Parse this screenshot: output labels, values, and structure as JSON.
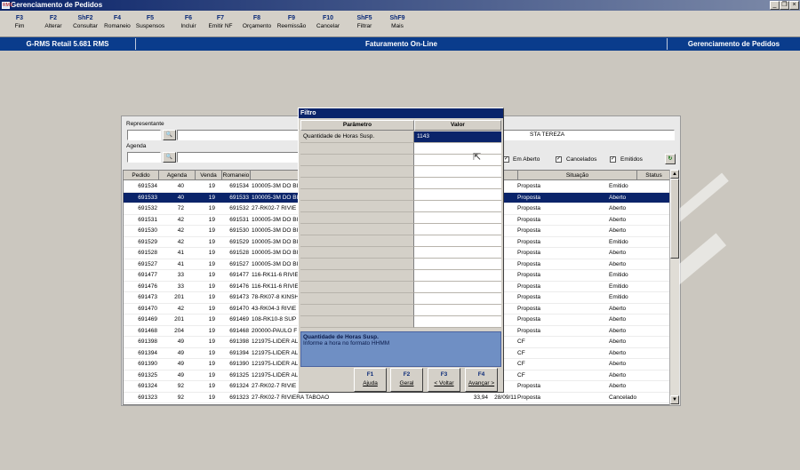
{
  "window": {
    "title": "Gerenciamento de Pedidos",
    "app_icon_text": "RMS"
  },
  "toolbar": [
    {
      "key": "F3",
      "label": "Fim"
    },
    {
      "key": "F2",
      "label": "Alterar"
    },
    {
      "key": "ShF2",
      "label": "Consultar"
    },
    {
      "key": "F4",
      "label": "Romaneio"
    },
    {
      "key": "F5",
      "label": "Suspensos"
    },
    {
      "key": "F6",
      "label": "Incluir"
    },
    {
      "key": "F7",
      "label": "Emitir NF"
    },
    {
      "key": "F8",
      "label": "Orçamento"
    },
    {
      "key": "F9",
      "label": "Reemissão"
    },
    {
      "key": "F10",
      "label": "Cancelar"
    },
    {
      "key": "ShF5",
      "label": "Filtrar"
    },
    {
      "key": "ShF9",
      "label": "Mais"
    }
  ],
  "banner": {
    "left": "G-RMS Retail 5.681 RMS",
    "center": "Faturamento On-Line",
    "right": "Gerenciamento de Pedidos"
  },
  "form": {
    "representante_label": "Representante",
    "agenda_label": "Agenda",
    "visible_name": "STA TEREZA",
    "chk_em_aberto": "Em Aberto",
    "chk_cancelados": "Cancelados",
    "chk_emitidos": "Emitidos"
  },
  "grid": {
    "headers": [
      "Pedido",
      "Agenda",
      "Venda",
      "Romaneio",
      "Situação",
      "Status"
    ],
    "rows": [
      [
        "691534",
        "40",
        "19",
        "691534",
        "100005-3M DO BI",
        "",
        "",
        "Proposta",
        "Emitido"
      ],
      [
        "691533",
        "40",
        "19",
        "691533",
        "100005-3M DO BI",
        "",
        "",
        "Proposta",
        "Aberto"
      ],
      [
        "691532",
        "72",
        "19",
        "691532",
        "27-RK02-7 RIVIE",
        "",
        "",
        "Proposta",
        "Aberto"
      ],
      [
        "691531",
        "42",
        "19",
        "691531",
        "100005-3M DO BI",
        "",
        "",
        "Proposta",
        "Aberto"
      ],
      [
        "691530",
        "42",
        "19",
        "691530",
        "100005-3M DO BI",
        "",
        "",
        "Proposta",
        "Aberto"
      ],
      [
        "691529",
        "42",
        "19",
        "691529",
        "100005-3M DO BI",
        "",
        "",
        "Proposta",
        "Emitido"
      ],
      [
        "691528",
        "41",
        "19",
        "691528",
        "100005-3M DO BI",
        "",
        "",
        "Proposta",
        "Aberto"
      ],
      [
        "691527",
        "41",
        "19",
        "691527",
        "100005-3M DO BI",
        "",
        "",
        "Proposta",
        "Aberto"
      ],
      [
        "691477",
        "33",
        "19",
        "691477",
        "116-RK11-6 RIVIE",
        "",
        "",
        "Proposta",
        "Emitido"
      ],
      [
        "691476",
        "33",
        "19",
        "691476",
        "116-RK11-6 RIVIE",
        "",
        "",
        "Proposta",
        "Emitido"
      ],
      [
        "691473",
        "201",
        "19",
        "691473",
        "78-RK07-8 KINSH",
        "",
        "",
        "Proposta",
        "Emitido"
      ],
      [
        "691470",
        "42",
        "19",
        "691470",
        "43-RK04-3 RIVIE",
        "",
        "",
        "Proposta",
        "Aberto"
      ],
      [
        "691469",
        "201",
        "19",
        "691469",
        "108-RK10-8 SUP",
        "",
        "",
        "Proposta",
        "Aberto"
      ],
      [
        "691468",
        "204",
        "19",
        "691468",
        "200000-PAULO F",
        "",
        "",
        "Proposta",
        "Aberto"
      ],
      [
        "691398",
        "49",
        "19",
        "691398",
        "121975-LIDER AL",
        "",
        "",
        "CF",
        "Aberto"
      ],
      [
        "691394",
        "49",
        "19",
        "691394",
        "121975-LIDER AL",
        "",
        "",
        "CF",
        "Aberto"
      ],
      [
        "691390",
        "49",
        "19",
        "691390",
        "121975-LIDER AL",
        "",
        "",
        "CF",
        "Aberto"
      ],
      [
        "691325",
        "49",
        "19",
        "691325",
        "121975-LIDER AL",
        "",
        "",
        "CF",
        "Aberto"
      ],
      [
        "691324",
        "92",
        "19",
        "691324",
        "27-RK02-7 RIVIE",
        "",
        "",
        "Proposta",
        "Aberto"
      ],
      [
        "691323",
        "92",
        "19",
        "691323",
        "27-RK02-7 RIVIERA TABOAO",
        "33,94",
        "28/09/11",
        "Proposta",
        "Cancelado"
      ]
    ],
    "selected_row": 1
  },
  "dialog": {
    "title": "Filtro",
    "col_param": "Parâmetro",
    "col_value": "Valor",
    "param": "Quantidade de Horas Susp.",
    "value": "1143",
    "help_title": "Quantidade de Horas Susp.",
    "help_text": "Informe a hora no formato HHMM",
    "buttons": [
      {
        "key": "F1",
        "label": "Ajuda"
      },
      {
        "key": "F2",
        "label": "Geral"
      },
      {
        "key": "F3",
        "label": "< Voltar"
      },
      {
        "key": "F4",
        "label": "Avançar >"
      }
    ]
  }
}
